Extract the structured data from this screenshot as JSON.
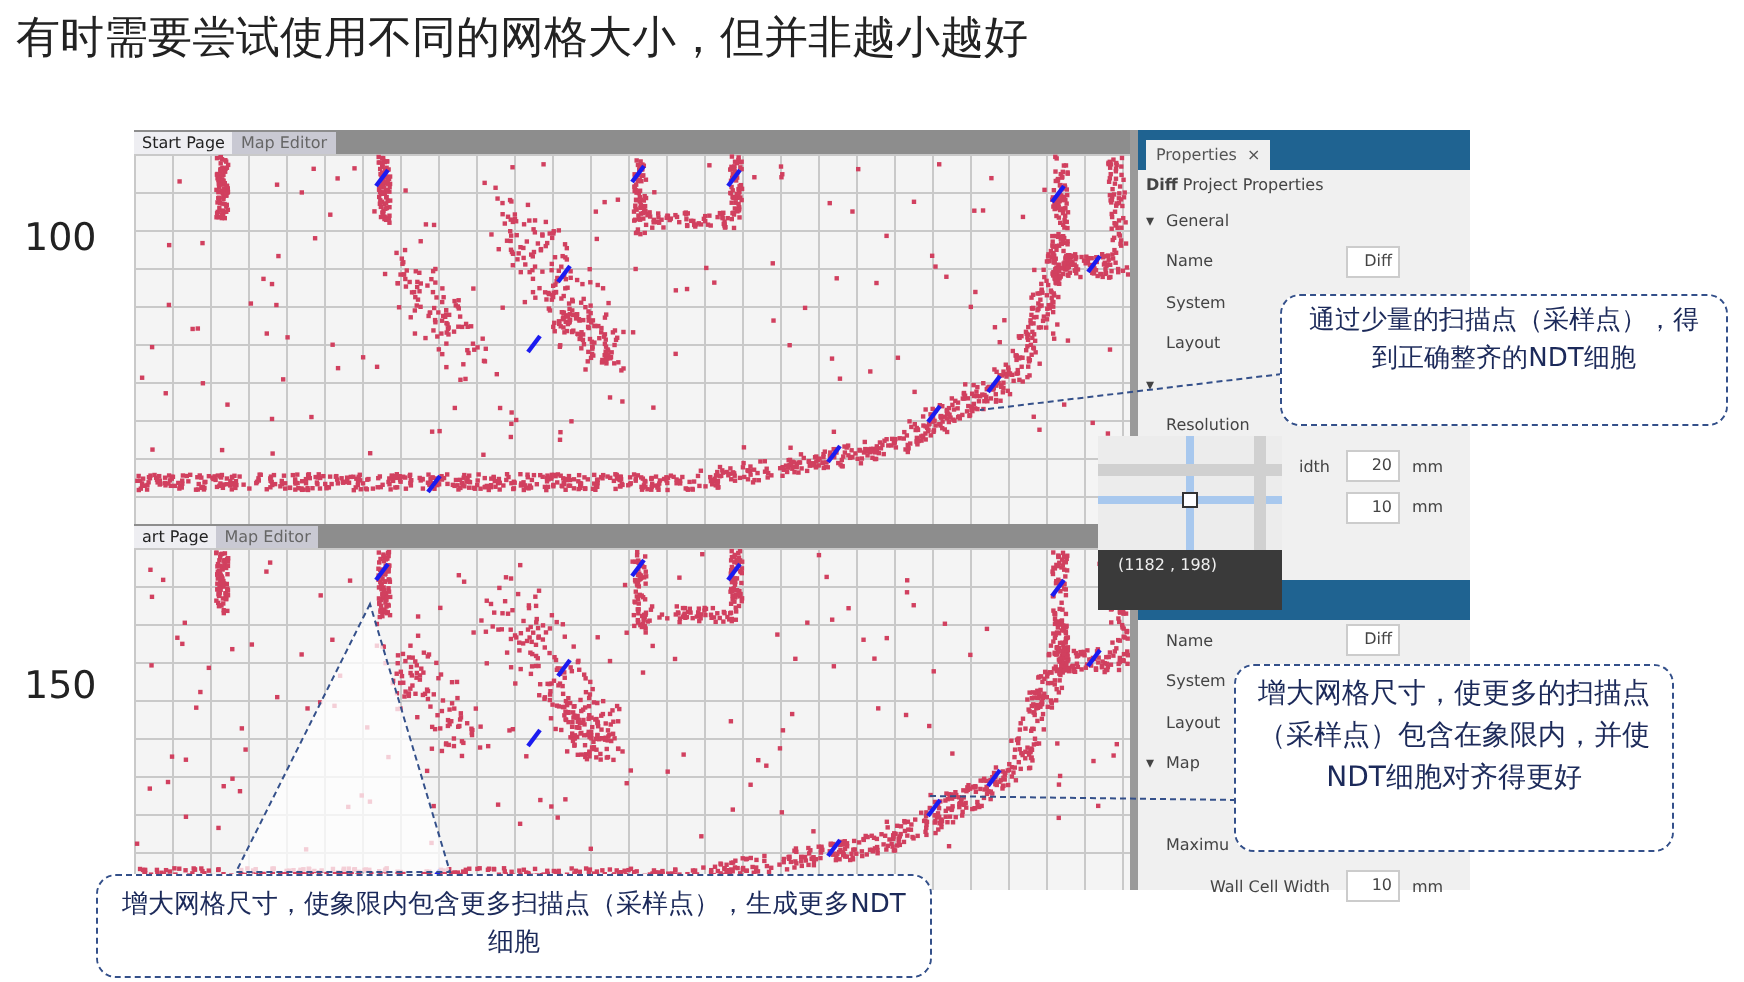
{
  "title": "有时需要尝试使用不同的网格大小，但并非越小越好",
  "panels": [
    {
      "label": "100",
      "tabs": [
        {
          "label": "Start Page",
          "selected": true
        },
        {
          "label": "Map Editor",
          "selected": false
        }
      ],
      "properties": {
        "tab": "Properties",
        "close": "×",
        "header_bold": "Diff",
        "header": "Project Properties",
        "rows": [
          {
            "kind": "section",
            "icon": "▾",
            "label": "General"
          },
          {
            "kind": "field",
            "label": "Name",
            "value": "Diff"
          },
          {
            "kind": "label",
            "label": "System"
          },
          {
            "kind": "label",
            "label": "Layout"
          },
          {
            "kind": "section",
            "icon": "▾"
          },
          {
            "kind": "label",
            "label": "Resolution"
          },
          {
            "kind": "field",
            "label": "idth",
            "value": "20",
            "unit": "mm"
          },
          {
            "kind": "field",
            "value": "10",
            "unit": "mm"
          }
        ]
      }
    },
    {
      "label": "150",
      "tabs": [
        {
          "label": "art Page",
          "selected": true
        },
        {
          "label": "Map Editor",
          "selected": false
        }
      ],
      "properties": {
        "rows": [
          {
            "kind": "field",
            "label": "Name",
            "value": "Diff"
          },
          {
            "kind": "label",
            "label": "System"
          },
          {
            "kind": "label",
            "label": "Layout"
          },
          {
            "kind": "section",
            "icon": "▾",
            "label": "Map"
          },
          {
            "kind": "spacer"
          },
          {
            "kind": "label",
            "label": "Maximu"
          },
          {
            "kind": "field",
            "label": "Wall Cell Width",
            "value": "10",
            "unit": "mm"
          }
        ]
      }
    }
  ],
  "tooltip": {
    "coords": "(1182 , 198)"
  },
  "callouts": [
    {
      "text": "通过少量的扫描点（采样点），得到正确整齐的NDT细胞"
    },
    {
      "text": "增大网格尺寸，使更多的扫描点（采样点）包含在象限内，并使NDT细胞对齐得更好"
    },
    {
      "text": "增大网格尺寸，使象限内包含更多扫描点（采样点），生成更多NDT细胞"
    }
  ]
}
